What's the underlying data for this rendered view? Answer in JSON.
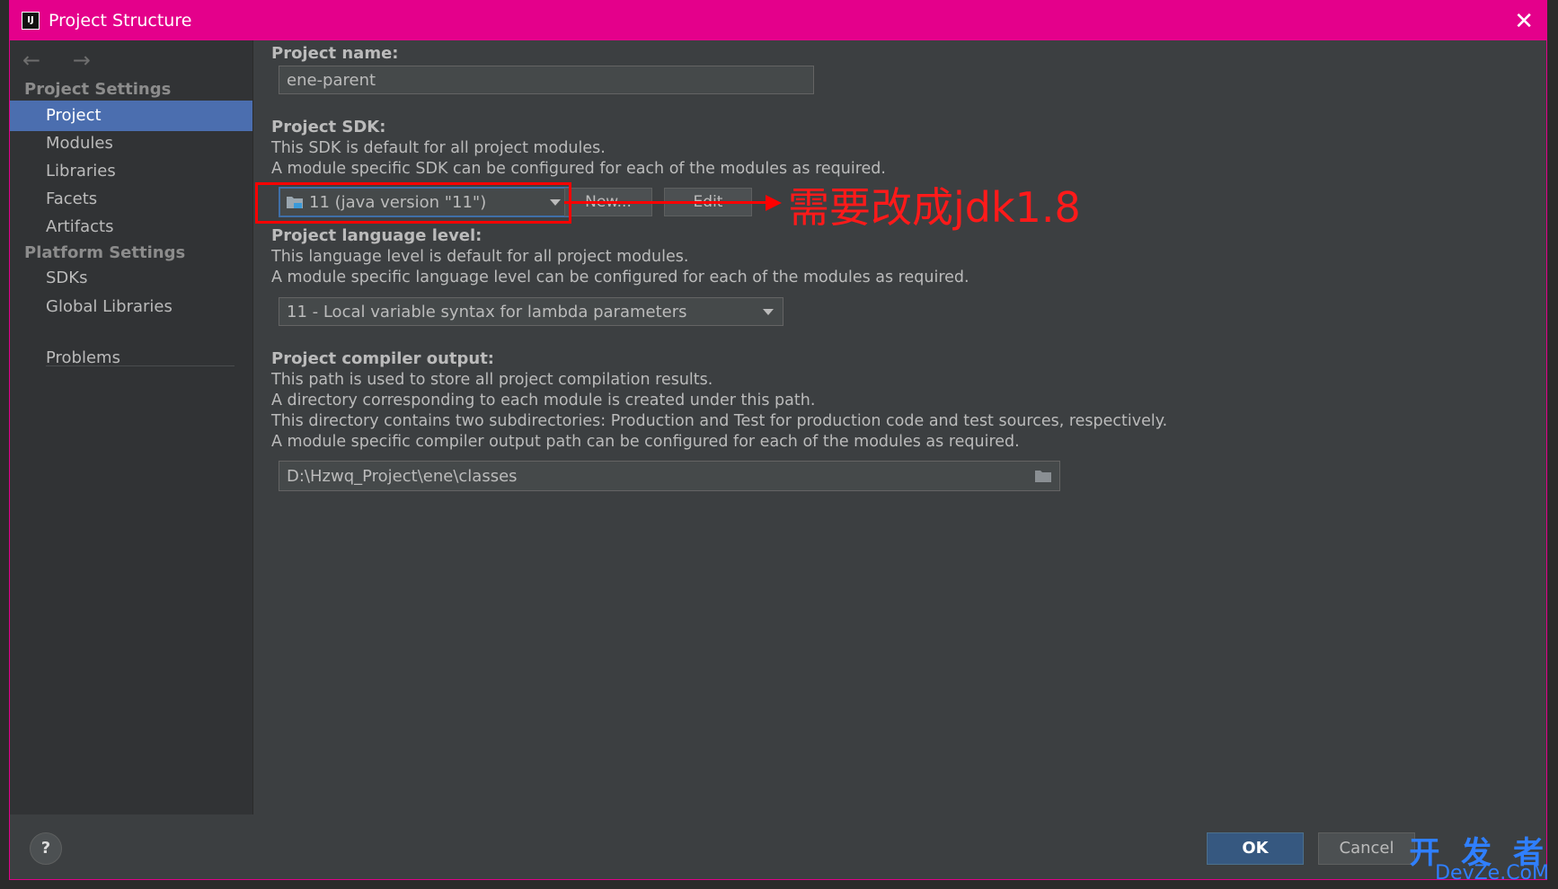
{
  "window": {
    "app_icon": "IJ",
    "title": "Project Structure",
    "close_glyph": "✕"
  },
  "sidebar": {
    "nav_glyphs": "← →",
    "project_settings_header": "Project Settings",
    "platform_settings_header": "Platform Settings",
    "items": [
      {
        "label": "Project"
      },
      {
        "label": "Modules"
      },
      {
        "label": "Libraries"
      },
      {
        "label": "Facets"
      },
      {
        "label": "Artifacts"
      },
      {
        "label": "SDKs"
      },
      {
        "label": "Global Libraries"
      },
      {
        "label": "Problems"
      }
    ]
  },
  "content": {
    "project_name_label": "Project name:",
    "project_name_value": "ene-parent",
    "sdk_label": "Project SDK:",
    "sdk_desc1": "This SDK is default for all project modules.",
    "sdk_desc2": "A module specific SDK can be configured for each of the modules as required.",
    "sdk_value": "11 (java version \"11\")",
    "sdk_new_button": "New...",
    "sdk_edit_button": "Edit",
    "lang_label": "Project language level:",
    "lang_desc1": "This language level is default for all project modules.",
    "lang_desc2": "A module specific language level can be configured for each of the modules as required.",
    "lang_value": "11 - Local variable syntax for lambda parameters",
    "output_label": "Project compiler output:",
    "output_desc1": "This path is used to store all project compilation results.",
    "output_desc2": "A directory corresponding to each module is created under this path.",
    "output_desc3": "This directory contains two subdirectories: Production and Test for production code and test sources, respectively.",
    "output_desc4": "A module specific compiler output path can be configured for each of the modules as required.",
    "output_value": "D:\\Hzwq_Project\\ene\\classes"
  },
  "annotation": {
    "text": "需要改成jdk1.8",
    "color": "#ff0000"
  },
  "footer": {
    "help_label": "?",
    "ok_label": "OK",
    "cancel_label": "Cancel"
  },
  "watermark": {
    "line1": "开 发 者",
    "line2": "DevZe.CoM",
    "color": "#2f7fff"
  },
  "colors": {
    "titlebar": "#e4008b",
    "selection": "#4b6eaf",
    "ok_button": "#365880"
  }
}
